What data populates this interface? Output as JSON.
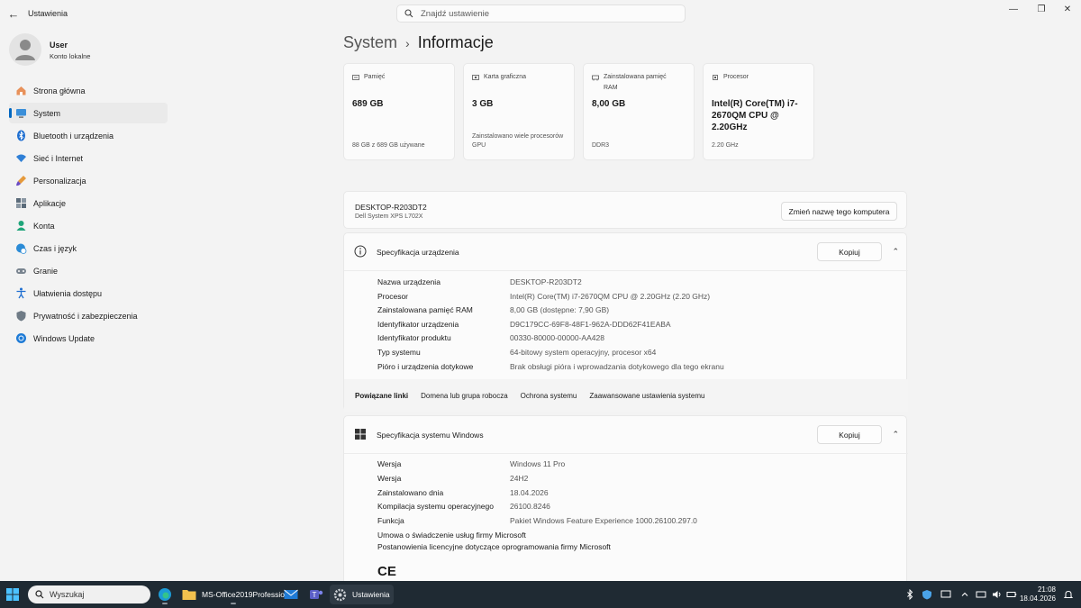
{
  "titlebar": {
    "app_title": "Ustawienia",
    "search_placeholder": "Znajdź ustawienie"
  },
  "user": {
    "name": "User",
    "account": "Konto lokalne"
  },
  "nav": {
    "items": [
      {
        "label": "Strona główna",
        "icon": "home-icon"
      },
      {
        "label": "System",
        "icon": "monitor-icon",
        "active": true
      },
      {
        "label": "Bluetooth i urządzenia",
        "icon": "bluetooth-icon"
      },
      {
        "label": "Sieć i Internet",
        "icon": "wifi-icon"
      },
      {
        "label": "Personalizacja",
        "icon": "brush-icon"
      },
      {
        "label": "Aplikacje",
        "icon": "apps-icon"
      },
      {
        "label": "Konta",
        "icon": "person-icon"
      },
      {
        "label": "Czas i język",
        "icon": "globe-clock-icon"
      },
      {
        "label": "Granie",
        "icon": "gamepad-icon"
      },
      {
        "label": "Ułatwienia dostępu",
        "icon": "accessibility-icon"
      },
      {
        "label": "Prywatność i zabezpieczenia",
        "icon": "shield-icon"
      },
      {
        "label": "Windows Update",
        "icon": "update-icon"
      }
    ]
  },
  "breadcrumb": {
    "parent": "System",
    "separator": "›",
    "current": "Informacje"
  },
  "cards": [
    {
      "title": "Pamięć",
      "value": "689 GB",
      "sub": "88 GB z 689 GB używane",
      "icon": "storage-icon"
    },
    {
      "title": "Karta graficzna",
      "value": "3 GB",
      "sub": "Zainstalowano wiele procesorów GPU",
      "icon": "gpu-icon"
    },
    {
      "title": "Zainstalowana pamięć RAM",
      "value": "8,00 GB",
      "sub": "DDR3",
      "icon": "ram-icon"
    },
    {
      "title": "Procesor",
      "value": "Intel(R) Core(TM) i7-2670QM CPU @ 2.20GHz",
      "sub": "2.20 GHz",
      "icon": "cpu-icon"
    }
  ],
  "pc": {
    "name": "DESKTOP-R203DT2",
    "model": "Dell System XPS L702X",
    "rename_label": "Zmień nazwę tego komputera"
  },
  "device_spec": {
    "title": "Specyfikacja urządzenia",
    "copy_label": "Kopiuj",
    "rows": [
      {
        "label": "Nazwa urządzenia",
        "value": "DESKTOP-R203DT2"
      },
      {
        "label": "Procesor",
        "value": "Intel(R) Core(TM) i7-2670QM CPU @ 2.20GHz (2.20 GHz)"
      },
      {
        "label": "Zainstalowana pamięć RAM",
        "value": "8,00 GB (dostępne: 7,90 GB)"
      },
      {
        "label": "Identyfikator urządzenia",
        "value": "D9C179CC-69F8-48F1-962A-DDD62F41EABA"
      },
      {
        "label": "Identyfikator produktu",
        "value": "00330-80000-00000-AA428"
      },
      {
        "label": "Typ systemu",
        "value": "64-bitowy system operacyjny, procesor x64"
      },
      {
        "label": "Pióro i urządzenia dotykowe",
        "value": "Brak obsługi pióra i wprowadzania dotykowego dla tego ekranu"
      }
    ]
  },
  "related": {
    "heading": "Powiązane linki",
    "links": [
      "Domena lub grupa robocza",
      "Ochrona systemu",
      "Zaawansowane ustawienia systemu"
    ]
  },
  "windows_spec": {
    "title": "Specyfikacja systemu Windows",
    "copy_label": "Kopiuj",
    "rows": [
      {
        "label": "Wersja",
        "value": "Windows 11 Pro"
      },
      {
        "label": "Wersja",
        "value": "24H2"
      },
      {
        "label": "Zainstalowano dnia",
        "value": "18.04.2026"
      },
      {
        "label": "Kompilacja systemu operacyjnego",
        "value": "26100.8246"
      },
      {
        "label": "Funkcja",
        "value": "Pakiet Windows Feature Experience 1000.26100.297.0"
      }
    ],
    "links": [
      "Umowa o świadczenie usług firmy Microsoft",
      "Postanowienia licencyjne dotyczące oprogramowania firmy Microsoft"
    ],
    "ce_mark": "CE"
  },
  "taskbar": {
    "search_label": "Wyszukaj",
    "apps": [
      {
        "label": "",
        "icon": "edge-icon"
      },
      {
        "label": "MS-Office2019Professio",
        "icon": "folder-icon"
      },
      {
        "label": "",
        "icon": "mail-icon"
      },
      {
        "label": "",
        "icon": "teams-icon"
      },
      {
        "label": "Ustawienia",
        "icon": "settings-icon"
      }
    ],
    "time": "21:08",
    "date": "18.04.2026"
  },
  "colors": {
    "accent": "#0067c0",
    "taskbar": "#1f2a33"
  }
}
